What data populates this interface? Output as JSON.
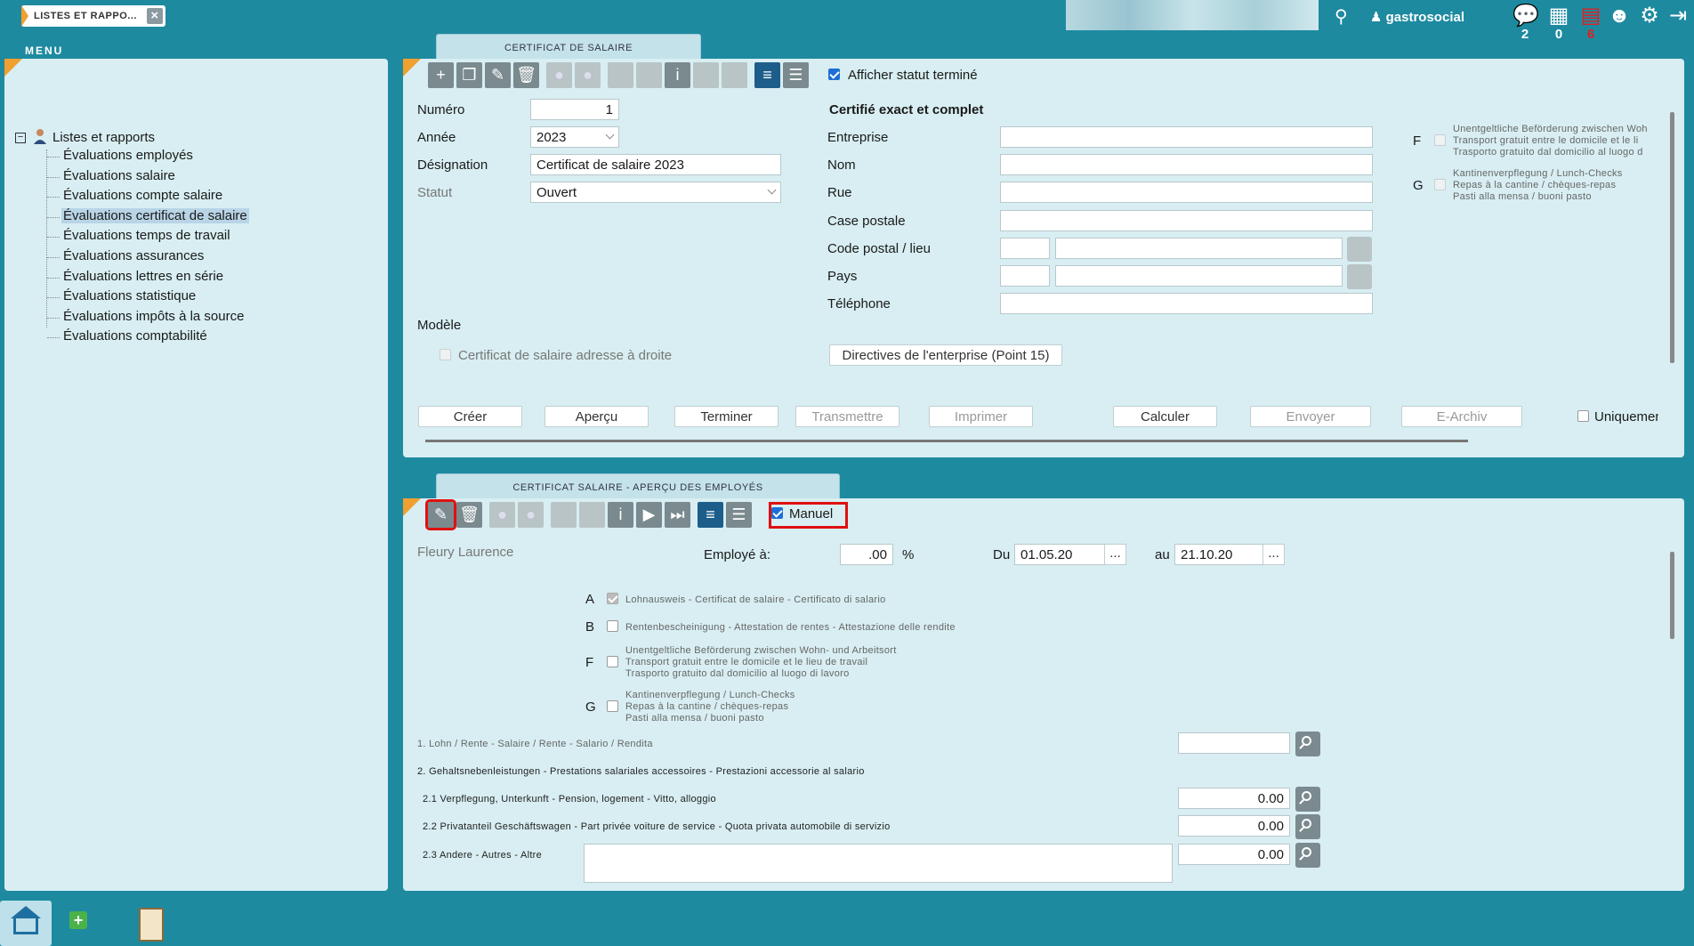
{
  "top": {
    "tab_label": "LISTES ET RAPPO...",
    "user": "gastrosocial",
    "counts": [
      "2",
      "0",
      "6"
    ]
  },
  "menu_label": "MENU",
  "tree": {
    "root": "Listes et rapports",
    "items": [
      "Évaluations employés",
      "Évaluations salaire",
      "Évaluations compte salaire",
      "Évaluations certificat de salaire",
      "Évaluations temps de travail",
      "Évaluations assurances",
      "Évaluations lettres en série",
      "Évaluations statistique",
      "Évaluations impôts à la source",
      "Évaluations comptabilité"
    ]
  },
  "cert": {
    "tab": "CERTIFICAT DE SALAIRE",
    "show_finished": "Afficher statut terminé",
    "labels": {
      "numero": "Numéro",
      "annee": "Année",
      "designation": "Désignation",
      "statut": "Statut",
      "modele": "Modèle",
      "entreprise": "Entreprise",
      "nom": "Nom",
      "rue": "Rue",
      "case_postale": "Case postale",
      "code_postal": "Code postal / lieu",
      "pays": "Pays",
      "telephone": "Téléphone"
    },
    "values": {
      "numero": "1",
      "annee": "2023",
      "designation": "Certificat de salaire 2023",
      "statut": "Ouvert"
    },
    "certified_heading": "Certifié exact et complet",
    "address_right": "Certificat de salaire adresse à droite",
    "directives": "Directives de l'enterprise (Point 15)",
    "F_text": [
      "Unentgeltliche Beförderung zwischen Woh",
      "Transport gratuit entre le domicile et le li",
      "Trasporto gratuito dal domicilio al luogo d"
    ],
    "G_text": [
      "Kantinenverpflegung / Lunch-Checks",
      "Repas à la cantine / chèques-repas",
      "Pasti alla mensa / buoni pasto"
    ],
    "letters": {
      "F": "F",
      "G": "G"
    },
    "buttons": [
      "Créer",
      "Aperçu",
      "Terminer",
      "Transmettre",
      "Imprimer",
      "Calculer",
      "Envoyer",
      "E-Archiv"
    ],
    "only_label": "Uniquemen"
  },
  "emp": {
    "tab": "CERTIFICAT SALAIRE - APERÇU DES EMPLOYÉS",
    "manual": "Manuel",
    "name": "Fleury Laurence",
    "employed_label": "Employé à:",
    "percent_value": ".00",
    "percent_sign": "%",
    "du_label": "Du",
    "du_value": "01.05.20",
    "au_label": "au",
    "au_value": "21.10.20",
    "dots": "...",
    "rows": [
      {
        "letter": "A",
        "text": "Lohnausweis - Certificat de salaire - Certificato di salario"
      },
      {
        "letter": "B",
        "text": "Rentenbescheinigung - Attestation de rentes - Attestazione delle rendite"
      }
    ],
    "F_letter": "F",
    "F_text": [
      "Unentgeltliche Beförderung zwischen Wohn- und Arbeitsort",
      "Transport gratuit entre le domicile et le lieu de travail",
      "Trasporto gratuito dal domicilio al luogo di lavoro"
    ],
    "G_letter": "G",
    "G_text": [
      "Kantinenverpflegung / Lunch-Checks",
      "Repas à la cantine / chèques-repas",
      "Pasti alla mensa / buoni pasto"
    ],
    "line1": "1. Lohn / Rente - Salaire / Rente - Salario / Rendita",
    "line2": "2. Gehaltsnebenleistungen - Prestations salariales accessoires - Prestazioni accessorie al salario",
    "line21": "2.1 Verpflegung, Unterkunft - Pension, logement - Vitto, alloggio",
    "line22": "2.2 Privatanteil Geschäftswagen - Part privée voiture de service - Quota privata automobile di servizio",
    "line23": "2.3 Andere - Autres - Altre",
    "val21": "0.00",
    "val22": "0.00",
    "val23": "0.00"
  },
  "icons": [
    "search-icon",
    "user-icon",
    "chat-icon",
    "calendar-icon",
    "clipboard-icon",
    "group-icon",
    "gear-icon",
    "logout-icon",
    "home-icon",
    "add-icon",
    "report-icon"
  ]
}
